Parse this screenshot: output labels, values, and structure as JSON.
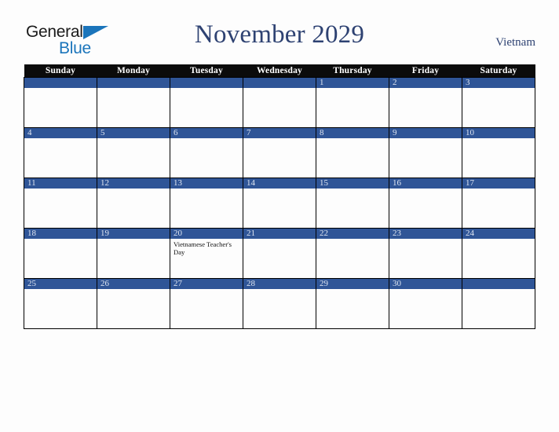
{
  "brand": {
    "name_part1": "General",
    "name_part2": "Blue"
  },
  "header": {
    "title": "November 2029",
    "country": "Vietnam"
  },
  "colors": {
    "day_bar": "#2F5597",
    "header_bar": "#0B0B0B",
    "title_text": "#2E4272",
    "logo_blue": "#1B75BB",
    "page_background": "#FDFDFD"
  },
  "weekday_headers": [
    "Sunday",
    "Monday",
    "Tuesday",
    "Wednesday",
    "Thursday",
    "Friday",
    "Saturday"
  ],
  "weeks": [
    [
      {
        "day": "",
        "events": []
      },
      {
        "day": "",
        "events": []
      },
      {
        "day": "",
        "events": []
      },
      {
        "day": "",
        "events": []
      },
      {
        "day": "1",
        "events": []
      },
      {
        "day": "2",
        "events": []
      },
      {
        "day": "3",
        "events": []
      }
    ],
    [
      {
        "day": "4",
        "events": []
      },
      {
        "day": "5",
        "events": []
      },
      {
        "day": "6",
        "events": []
      },
      {
        "day": "7",
        "events": []
      },
      {
        "day": "8",
        "events": []
      },
      {
        "day": "9",
        "events": []
      },
      {
        "day": "10",
        "events": []
      }
    ],
    [
      {
        "day": "11",
        "events": []
      },
      {
        "day": "12",
        "events": []
      },
      {
        "day": "13",
        "events": []
      },
      {
        "day": "14",
        "events": []
      },
      {
        "day": "15",
        "events": []
      },
      {
        "day": "16",
        "events": []
      },
      {
        "day": "17",
        "events": []
      }
    ],
    [
      {
        "day": "18",
        "events": []
      },
      {
        "day": "19",
        "events": []
      },
      {
        "day": "20",
        "events": [
          "Vietnamese Teacher's Day"
        ]
      },
      {
        "day": "21",
        "events": []
      },
      {
        "day": "22",
        "events": []
      },
      {
        "day": "23",
        "events": []
      },
      {
        "day": "24",
        "events": []
      }
    ],
    [
      {
        "day": "25",
        "events": []
      },
      {
        "day": "26",
        "events": []
      },
      {
        "day": "27",
        "events": []
      },
      {
        "day": "28",
        "events": []
      },
      {
        "day": "29",
        "events": []
      },
      {
        "day": "30",
        "events": []
      },
      {
        "day": "",
        "events": []
      }
    ]
  ]
}
